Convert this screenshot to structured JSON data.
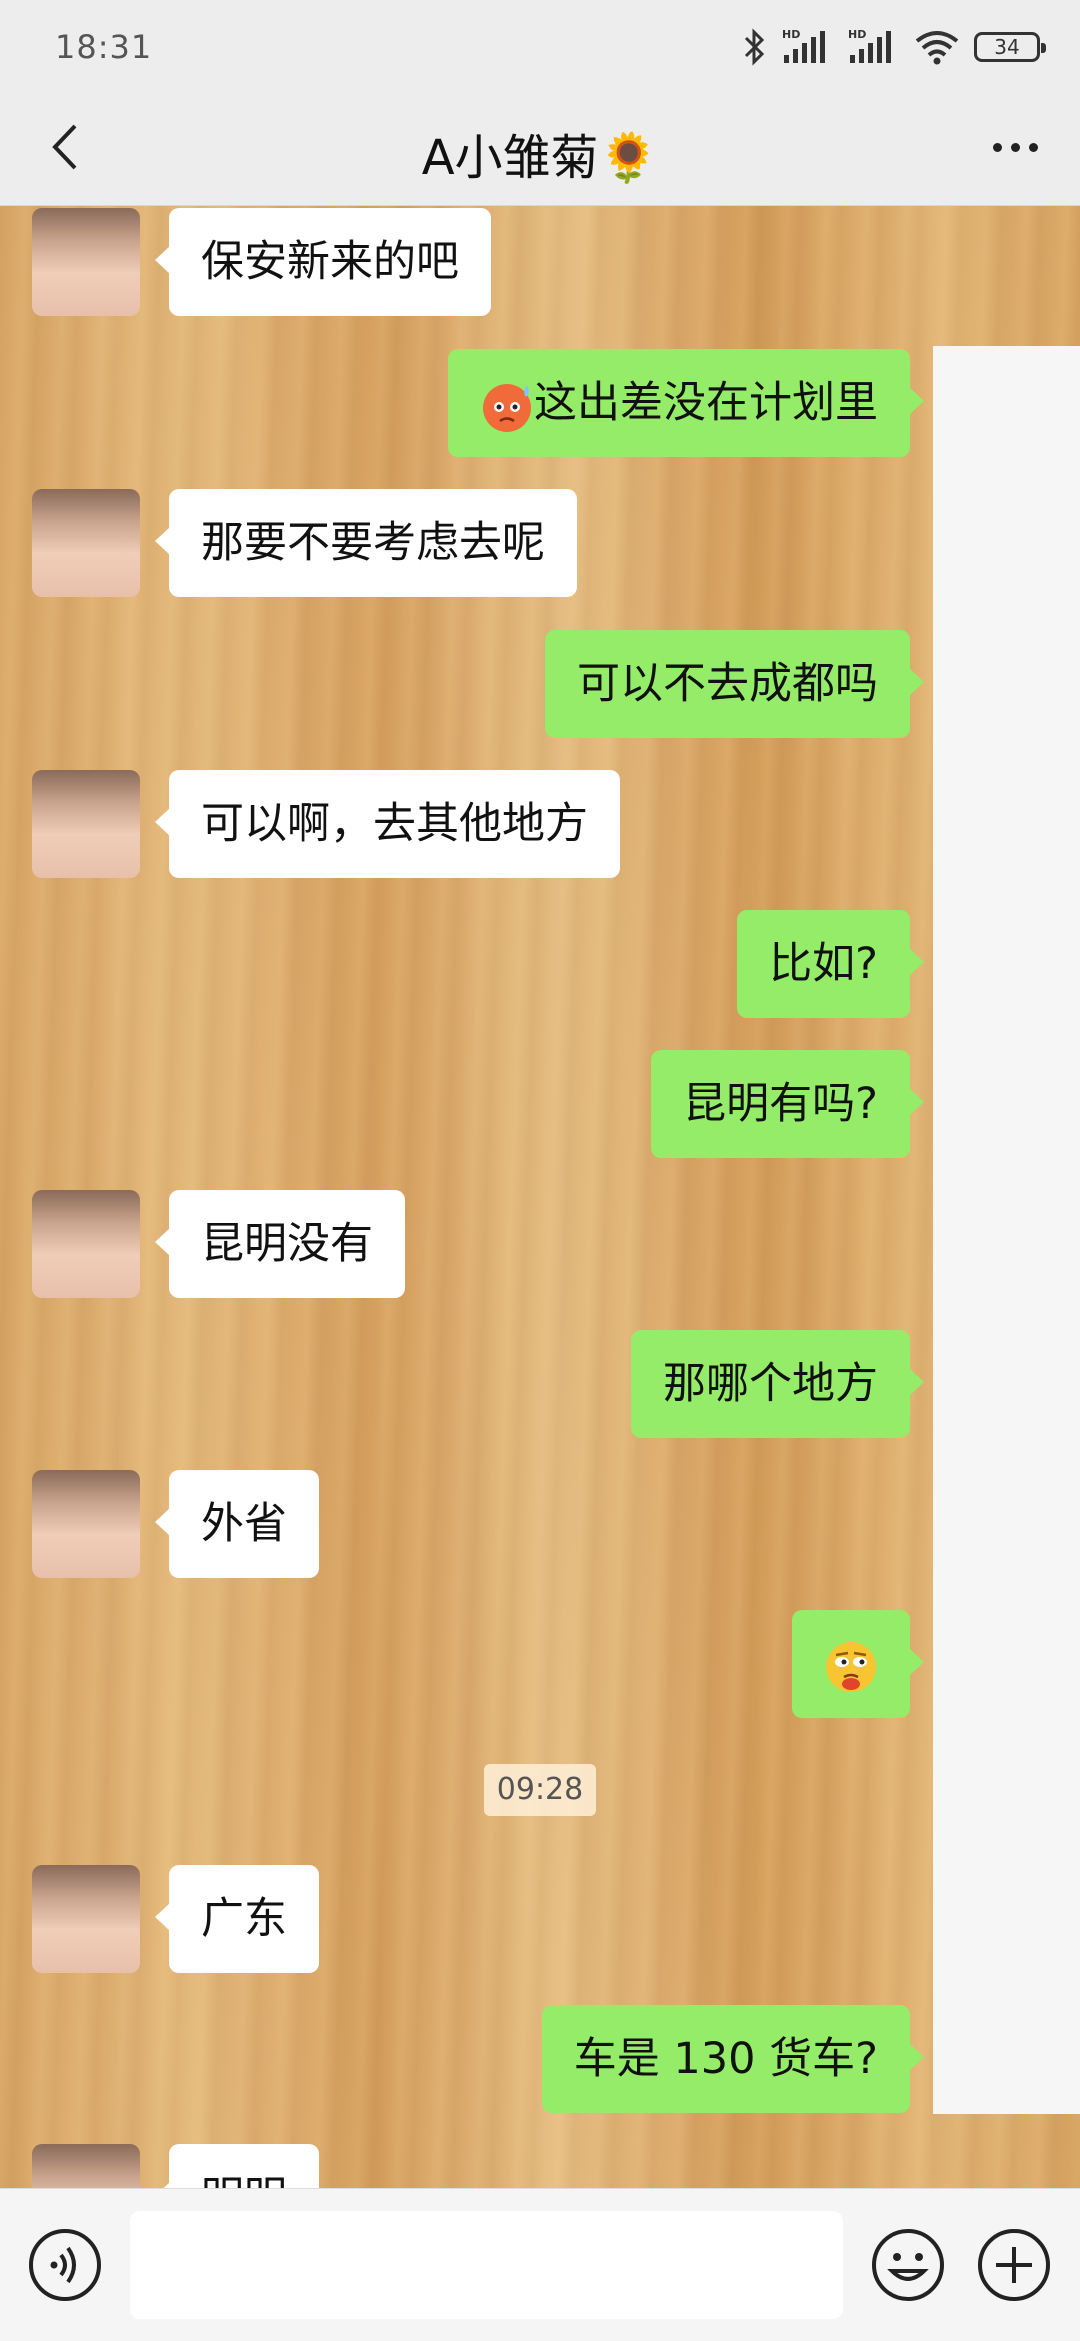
{
  "status_bar": {
    "time": "18:31",
    "battery": "34"
  },
  "header": {
    "title": "A小雏菊🌻"
  },
  "messages": [
    {
      "side": "in",
      "text": "保安新来的吧"
    },
    {
      "side": "out",
      "text": "这出差没在计划里",
      "emoji": "anxious-sweat-emoji"
    },
    {
      "side": "in",
      "text": "那要不要考虑去呢"
    },
    {
      "side": "out",
      "text": "可以不去成都吗"
    },
    {
      "side": "in",
      "text": "可以啊，去其他地方"
    },
    {
      "side": "out",
      "text": "比如?"
    },
    {
      "side": "out",
      "text": "昆明有吗?"
    },
    {
      "side": "in",
      "text": "昆明没有"
    },
    {
      "side": "out",
      "text": "那哪个地方"
    },
    {
      "side": "in",
      "text": "外省"
    },
    {
      "side": "out",
      "text": "",
      "emoji": "thinking-face-emoji"
    },
    {
      "side": "in",
      "text": "广东"
    },
    {
      "side": "out",
      "text": "车是 130 货车?"
    },
    {
      "side": "in",
      "text": "明明"
    }
  ],
  "time_divider": "09:28",
  "input": {
    "placeholder": ""
  }
}
